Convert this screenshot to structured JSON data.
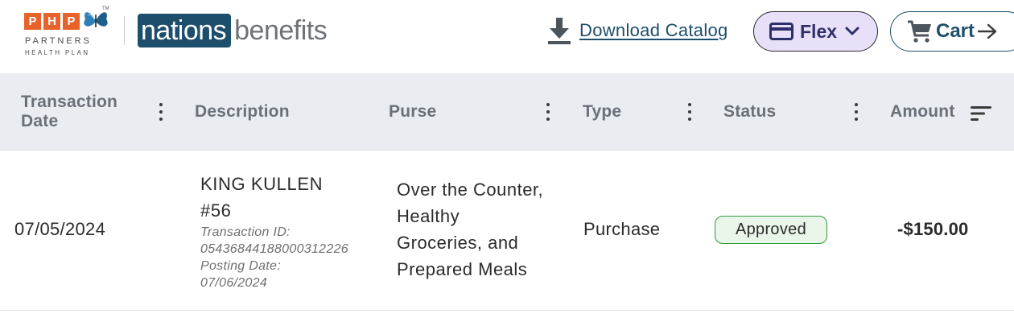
{
  "header": {
    "php_logo": {
      "letters": [
        "P",
        "H",
        "P"
      ],
      "tm": "TM",
      "line1": "PARTNERS",
      "line2": "HEALTH PLAN"
    },
    "brand": {
      "part1": "nations",
      "part2": "benefits"
    },
    "download": {
      "icon": "download-icon",
      "label": "Download Catalog"
    },
    "flex_menu": {
      "icon": "credit-card-icon",
      "label": "Flex",
      "chevron": "chevron-down-icon"
    },
    "cart": {
      "icon": "cart-icon",
      "label": "Cart",
      "arrow": "arrow-right-icon"
    }
  },
  "table": {
    "columns": [
      {
        "label": "Transaction Date",
        "has_menu": true
      },
      {
        "label": "Description",
        "has_menu": false
      },
      {
        "label": "Purse",
        "has_menu": true
      },
      {
        "label": "Type",
        "has_menu": true
      },
      {
        "label": "Status",
        "has_menu": true
      },
      {
        "label": "Amount",
        "has_sort": true
      }
    ],
    "rows": [
      {
        "date": "07/05/2024",
        "merchant_line1": "KING KULLEN",
        "merchant_line2": "#56",
        "transaction_id_label": "Transaction ID:",
        "transaction_id": "05436844188000312226",
        "posting_date_label": "Posting Date:",
        "posting_date": "07/06/2024",
        "purse_lines": [
          "Over the Counter,",
          "Healthy",
          "Groceries, and",
          "Prepared Meals"
        ],
        "type": "Purchase",
        "status": "Approved",
        "amount": "-$150.00"
      }
    ]
  },
  "colors": {
    "brand_navy": "#1d4e6b",
    "php_orange": "#e8632b",
    "flex_bg": "#e7e0f8",
    "header_bg": "#e9edf2",
    "approved_border": "#2f9c3e",
    "approved_bg": "#e9f5e8"
  }
}
